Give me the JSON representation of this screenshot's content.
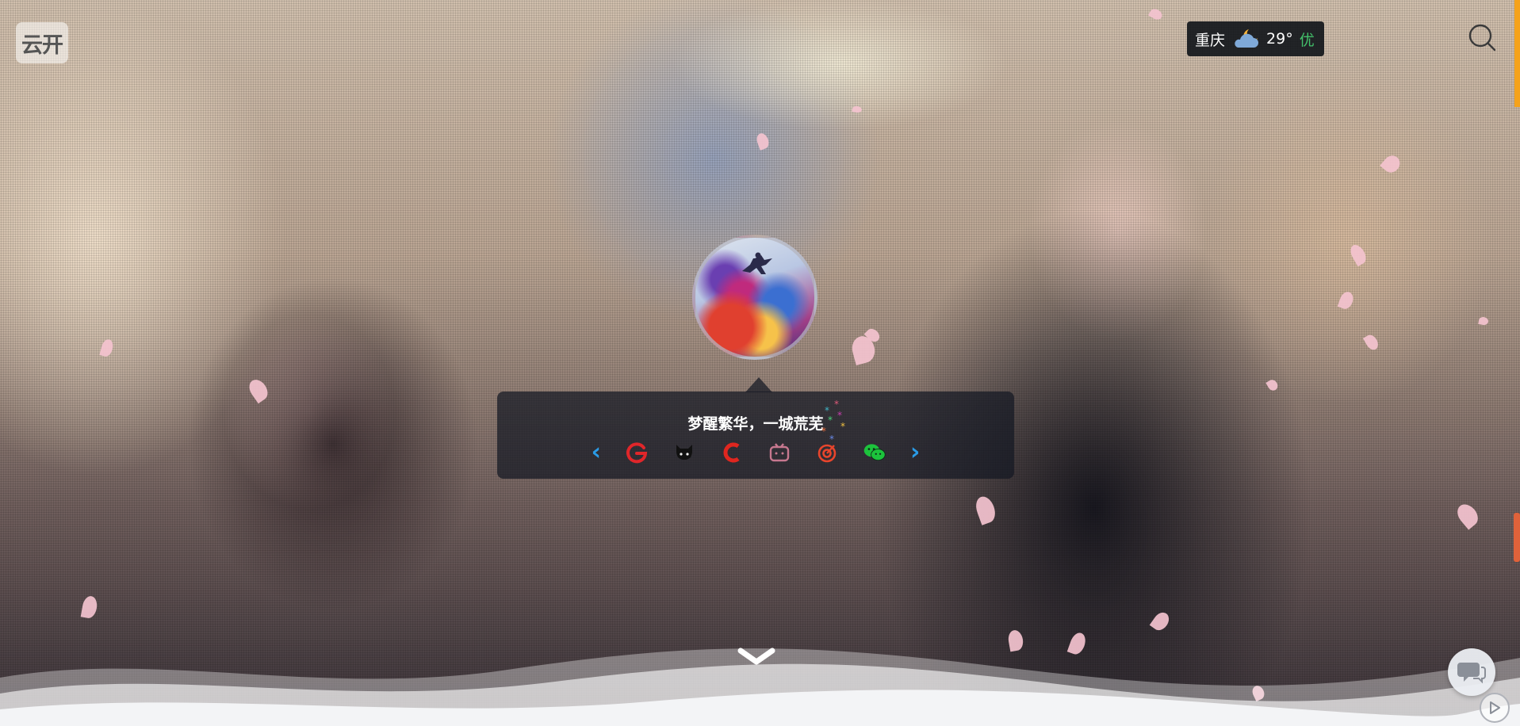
{
  "header": {
    "logo_text": "云开",
    "logo_subtitle": ""
  },
  "weather": {
    "city": "重庆",
    "icon": "partly-cloudy-night-icon",
    "temperature": "29°",
    "air_quality": "优",
    "air_quality_color": "#43c06a"
  },
  "profile": {
    "motto": "梦醒繁华，一城荒芜"
  },
  "social_links": [
    {
      "name": "google-icon",
      "color": "#e0262a"
    },
    {
      "name": "github-icon",
      "color": "#111111"
    },
    {
      "name": "csdn-icon",
      "color": "#e0261f"
    },
    {
      "name": "bilibili-icon",
      "color": "#c7788f"
    },
    {
      "name": "target-icon",
      "color": "#e8452c"
    },
    {
      "name": "wechat-icon",
      "color": "#1cc33c"
    }
  ],
  "colors": {
    "accent_arrow": "#2a9be6",
    "scroll_strip": "#f5a21a",
    "scroll_thumb": "#e0623a"
  }
}
